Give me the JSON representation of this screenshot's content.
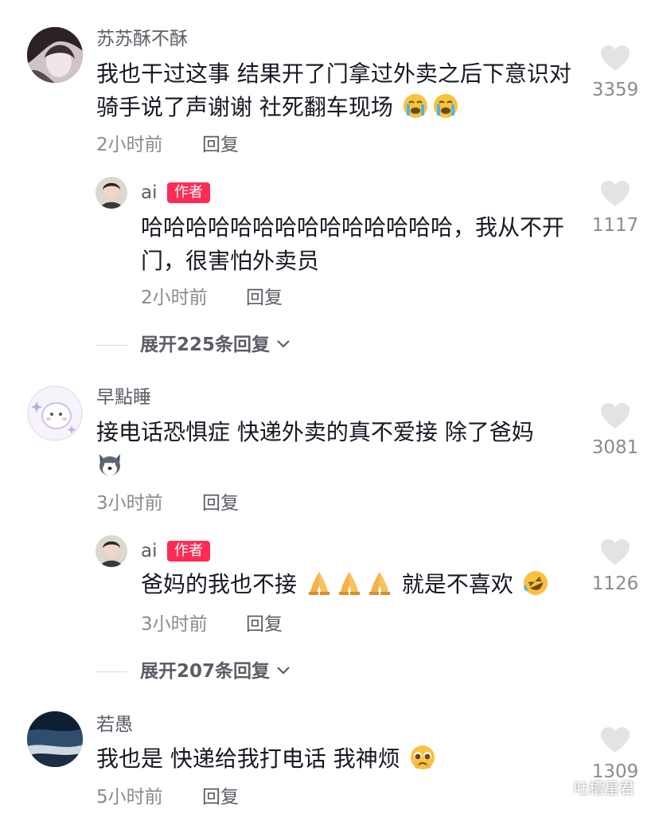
{
  "comments": [
    {
      "user": "苏苏酥不酥",
      "text": "我也干过这事 结果开了门拿过外卖之后下意识对骑手说了声谢谢 社死翻车现场",
      "emojis": [
        "loudly-crying-face",
        "loudly-crying-face"
      ],
      "time": "2小时前",
      "reply_label": "回复",
      "likes": "3359",
      "author_reply": {
        "user": "ai",
        "badge": "作者",
        "text": "哈哈哈哈哈哈哈哈哈哈哈哈哈哈，我从不开门，很害怕外卖员",
        "time": "2小时前",
        "reply_label": "回复",
        "likes": "1117"
      },
      "expand_label": "展开225条回复"
    },
    {
      "user": "早點睡",
      "text": "接电话恐惧症 快递外卖的真不爱接 除了爸妈",
      "emojis": [
        "dog-face-sticker"
      ],
      "time": "3小时前",
      "reply_label": "回复",
      "likes": "3081",
      "author_reply": {
        "user": "ai",
        "badge": "作者",
        "text": "爸妈的我也不接",
        "text2": "就是不喜欢",
        "emojis": [
          "folded-hands",
          "folded-hands",
          "folded-hands",
          "rolling-laughing-face"
        ],
        "time": "3小时前",
        "reply_label": "回复",
        "likes": "1126"
      },
      "expand_label": "展开207条回复"
    },
    {
      "user": "若愚",
      "text": "我也是 快递给我打电话 我神烦",
      "emojis": [
        "pleading-face"
      ],
      "time": "5小时前",
      "reply_label": "回复",
      "likes": "1309"
    }
  ],
  "watermark": "吐槽星君",
  "colors": {
    "badge": "#fe2c55",
    "secondary_text": "#8a8b91",
    "heart": "#e3e3e6"
  }
}
